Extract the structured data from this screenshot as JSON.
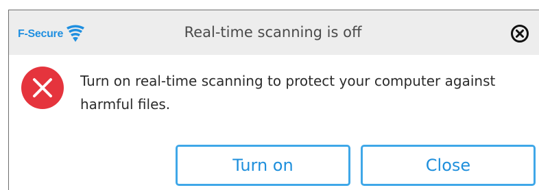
{
  "window": {
    "brand_name": "F-Secure",
    "title": "Real-time scanning is off"
  },
  "icons": {
    "brand_logo": "f-secure-wing-logo",
    "close": "close-circle-icon",
    "status": "error-x-icon"
  },
  "content": {
    "message": "Turn on real-time scanning to protect your computer against harmful files."
  },
  "buttons": {
    "turn_on_label": "Turn on",
    "close_label": "Close"
  },
  "colors": {
    "accent": "#1e8fdc",
    "button_border": "#3fa7e8",
    "error": "#e5343d",
    "titlebar_bg": "#ededed"
  }
}
